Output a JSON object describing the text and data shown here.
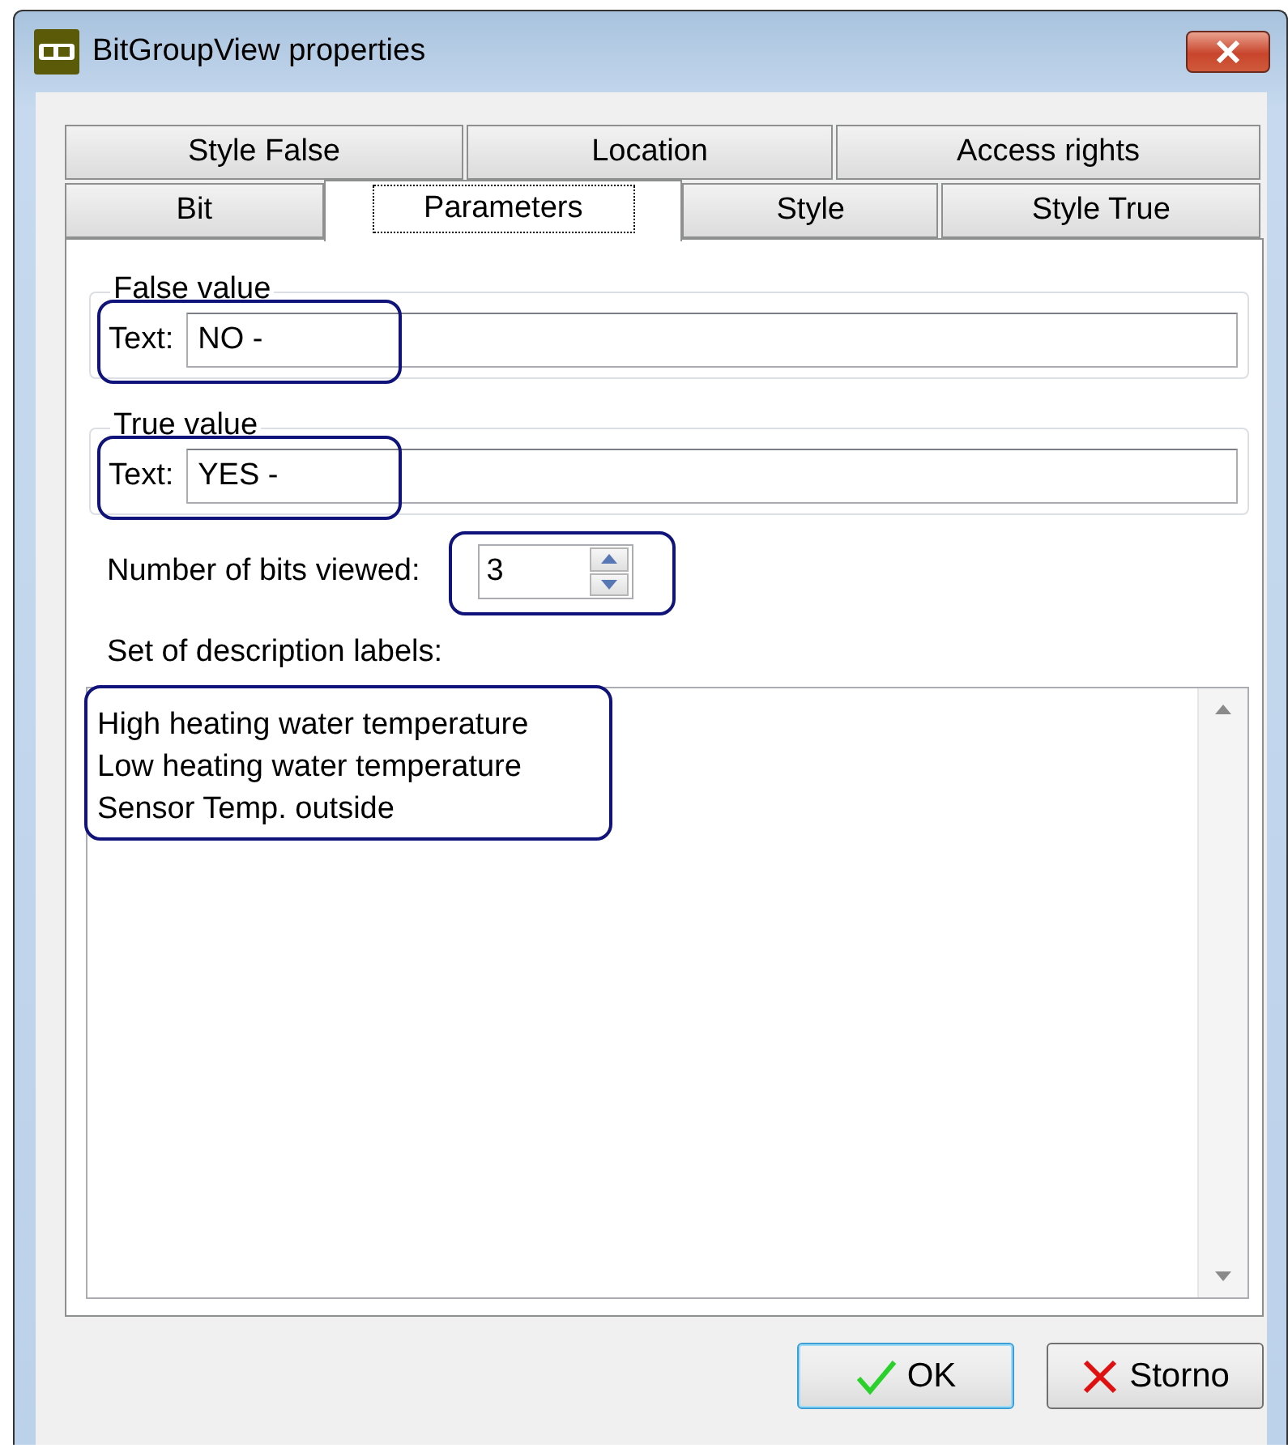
{
  "window": {
    "title": "BitGroupView properties"
  },
  "tabs": [
    [
      {
        "label": "Style False",
        "selected": false
      },
      {
        "label": "Location",
        "selected": false
      },
      {
        "label": "Access rights",
        "selected": false
      }
    ],
    [
      {
        "label": "Bit",
        "selected": false
      },
      {
        "label": "Parameters",
        "selected": true
      },
      {
        "label": "Style",
        "selected": false
      },
      {
        "label": "Style True",
        "selected": false
      }
    ]
  ],
  "groups": [
    {
      "title": "False value",
      "label": "Text:",
      "value": "NO -",
      "highlighted": true
    },
    {
      "title": "True value",
      "label": "Text:",
      "value": "YES -",
      "highlighted": true
    }
  ],
  "bits": {
    "label": "Number of bits viewed:",
    "value": "3",
    "highlighted": true
  },
  "descriptions": {
    "label": "Set of description labels:",
    "lines": [
      "High heating water temperature",
      "Low heating water temperature",
      "Sensor Temp. outside"
    ],
    "highlighted": true
  },
  "buttons": [
    {
      "kind": "ok",
      "label": "OK"
    },
    {
      "kind": "cancel",
      "label": "Storno"
    }
  ]
}
